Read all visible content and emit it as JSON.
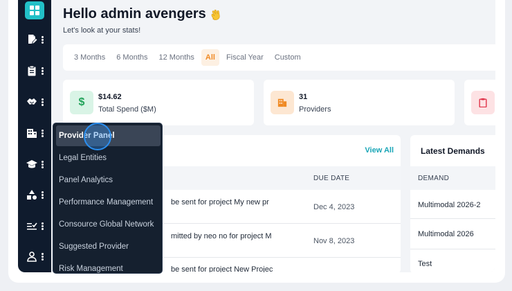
{
  "header": {
    "greeting": "Hello admin avengers",
    "subtitle": "Let's look at your stats!"
  },
  "filters": [
    "3 Months",
    "6 Months",
    "12 Months",
    "All",
    "Fiscal Year",
    "Custom"
  ],
  "active_filter": "All",
  "stats": [
    {
      "value": "$14.62",
      "label": "Total Spend ($M)",
      "icon": "dollar-icon",
      "color": "#d9f4e6",
      "icon_color": "#22a35a"
    },
    {
      "value": "31",
      "label": "Providers",
      "icon": "building-icon",
      "color": "#fde7d2",
      "icon_color": "#f08a24"
    },
    {
      "value": "",
      "label": "",
      "icon": "clipboard-icon",
      "color": "#fde2e4",
      "icon_color": "#e0344a"
    }
  ],
  "tasks_panel": {
    "view_all": "View All",
    "due_header": "DUE DATE",
    "rows": [
      {
        "text": "be sent for project My new pr",
        "due": "Dec 4, 2023"
      },
      {
        "text": "mitted by neo no for project M",
        "due": "Nov 8, 2023"
      },
      {
        "text": "be sent for project New Projec",
        "due": ""
      }
    ]
  },
  "demands_panel": {
    "title": "Latest Demands",
    "header": "DEMAND",
    "rows": [
      "Multimodal 2026-2",
      "Multimodal 2026",
      "Test"
    ]
  },
  "flyout_menu": {
    "items": [
      "Provider Panel",
      "Legal Entities",
      "Panel Analytics",
      "Performance Management",
      "Consource Global Network",
      "Suggested Provider",
      "Risk Management"
    ],
    "active": "Provider Panel"
  },
  "sidebar": {
    "icons": [
      "document-edit-icon",
      "clipboard-icon",
      "handshake-icon",
      "building-icon",
      "graduation-cap-icon",
      "shapes-icon",
      "checklist-icon",
      "user-icon"
    ]
  },
  "colors": {
    "accent": "#22c0c7",
    "active_filter": "#f08a24",
    "link": "#1aa6b7",
    "sidebar_bg": "#0f1b2d"
  }
}
